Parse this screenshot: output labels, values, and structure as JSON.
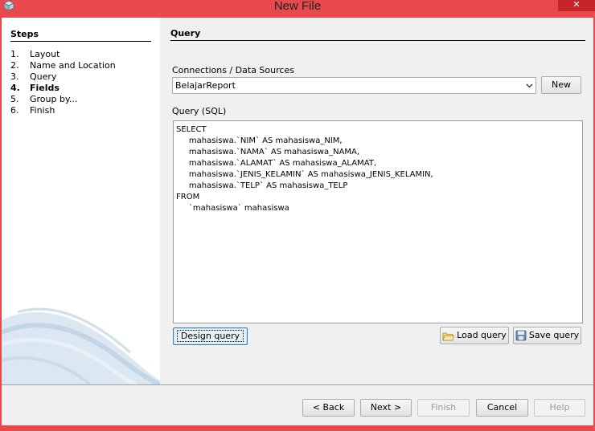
{
  "window": {
    "title": "New File",
    "close_glyph": "✕"
  },
  "steps": {
    "heading": "Steps",
    "items": [
      {
        "num": "1.",
        "label": "Layout"
      },
      {
        "num": "2.",
        "label": "Name and Location"
      },
      {
        "num": "3.",
        "label": "Query"
      },
      {
        "num": "4.",
        "label": "Fields",
        "active": true
      },
      {
        "num": "5.",
        "label": "Group by..."
      },
      {
        "num": "6.",
        "label": "Finish"
      }
    ]
  },
  "content": {
    "heading": "Query",
    "connection_label": "Connections / Data Sources",
    "connection_value": "BelajarReport",
    "new_button": "New",
    "query_label": "Query (SQL)",
    "query_text": "SELECT\n     mahasiswa.`NIM` AS mahasiswa_NIM,\n     mahasiswa.`NAMA` AS mahasiswa_NAMA,\n     mahasiswa.`ALAMAT` AS mahasiswa_ALAMAT,\n     mahasiswa.`JENIS_KELAMIN` AS mahasiswa_JENIS_KELAMIN,\n     mahasiswa.`TELP` AS mahasiswa_TELP\nFROM\n     `mahasiswa` mahasiswa",
    "design_query_button": "Design query",
    "load_query_button": "Load query",
    "save_query_button": "Save query"
  },
  "footer": {
    "back_button": "< Back",
    "next_button": "Next >",
    "finish_button": "Finish",
    "cancel_button": "Cancel",
    "help_button": "Help"
  },
  "icons": {
    "app": "cube-icon",
    "load": "open-folder-icon",
    "save": "save-disk-icon",
    "dropdown": "chevron-down-icon"
  },
  "colors": {
    "titlebar": "#e8494c",
    "close_button": "#c7252a",
    "panel_bg": "#f0f0f0",
    "steps_bg": "#ffffff"
  }
}
